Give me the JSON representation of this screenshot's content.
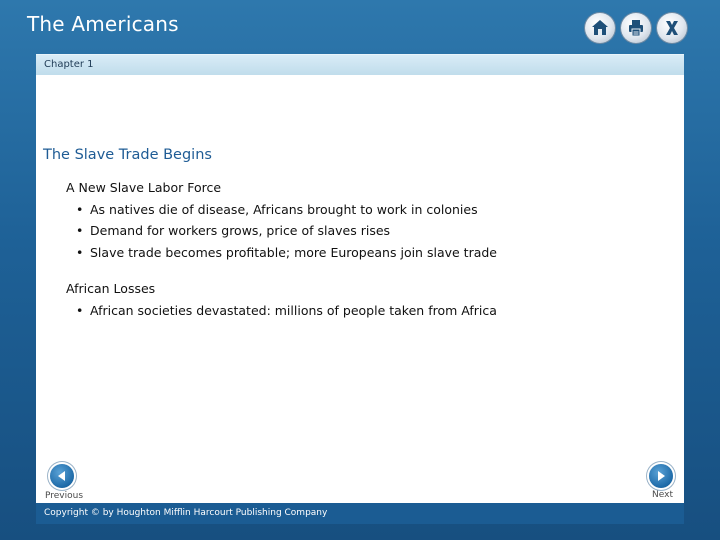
{
  "header": {
    "app_title": "The Americans",
    "buttons": {
      "home": "home-icon",
      "print": "print-icon",
      "close": "close-icon"
    }
  },
  "chapter_bar": {
    "label": "Chapter 1"
  },
  "slide": {
    "title": "The Slave Trade Begins",
    "sections": [
      {
        "heading": "A New Slave Labor Force",
        "bullets": [
          "As natives die of disease, Africans brought to work in colonies",
          "Demand for workers grows, price of slaves rises",
          "Slave trade becomes profitable; more Europeans join slave trade"
        ]
      },
      {
        "heading": "African Losses",
        "bullets": [
          "African societies devastated: millions of people taken from Africa"
        ]
      }
    ]
  },
  "navigation": {
    "previous_label": "Previous",
    "next_label": "Next"
  },
  "footer": {
    "copyright": "Copyright © by Houghton Mifflin Harcourt Publishing Company"
  },
  "colors": {
    "frame": "#1e6197",
    "title_text": "#1f5c95",
    "chapter_bar": "#cfe6f2",
    "footer": "#1b5c93"
  }
}
